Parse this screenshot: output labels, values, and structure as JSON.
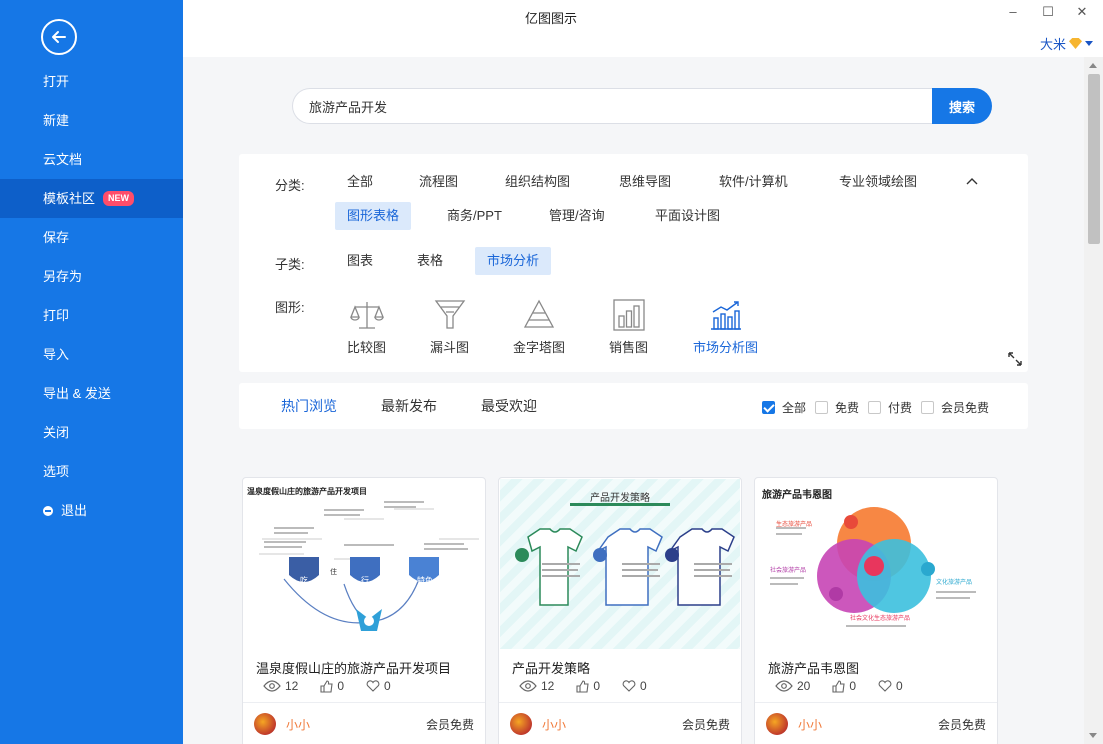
{
  "app": {
    "title": "亿图图示",
    "user": "大米"
  },
  "window": {
    "minimize": "–",
    "maximize": "☐",
    "close": "✕"
  },
  "sidebar": {
    "items": [
      {
        "label": "打开"
      },
      {
        "label": "新建"
      },
      {
        "label": "云文档"
      },
      {
        "label": "模板社区",
        "badge": "NEW"
      },
      {
        "label": "保存"
      },
      {
        "label": "另存为"
      },
      {
        "label": "打印"
      },
      {
        "label": "导入"
      },
      {
        "label": "导出 & 发送"
      },
      {
        "label": "关闭"
      },
      {
        "label": "选项"
      },
      {
        "label": "退出"
      }
    ]
  },
  "search": {
    "value": "旅游产品开发",
    "button": "搜索"
  },
  "filter": {
    "category_label": "分类:",
    "categories": [
      "全部",
      "流程图",
      "组织结构图",
      "思维导图",
      "软件/计算机",
      "专业领域绘图",
      "图形表格",
      "商务/PPT",
      "管理/咨询",
      "平面设计图"
    ],
    "subcategory_label": "子类:",
    "subcategories": [
      "图表",
      "表格",
      "市场分析"
    ],
    "shape_label": "图形:",
    "shapes": [
      {
        "label": "比较图",
        "icon": "scale-icon"
      },
      {
        "label": "漏斗图",
        "icon": "funnel-icon"
      },
      {
        "label": "金字塔图",
        "icon": "pyramid-icon"
      },
      {
        "label": "销售图",
        "icon": "bar-chart-icon"
      },
      {
        "label": "市场分析图",
        "icon": "market-chart-icon"
      }
    ]
  },
  "sort": {
    "tabs": [
      "热门浏览",
      "最新发布",
      "最受欢迎"
    ],
    "filters": [
      {
        "label": "全部",
        "checked": true
      },
      {
        "label": "免费",
        "checked": false
      },
      {
        "label": "付费",
        "checked": false
      },
      {
        "label": "会员免费",
        "checked": false
      }
    ]
  },
  "cards": [
    {
      "title": "温泉度假山庄的旅游产品开发项目",
      "thumb_title": "温泉度假山庄的旅游产品开发项目",
      "views": "12",
      "likes": "0",
      "favs": "0",
      "author": "小小",
      "price": "会员免费"
    },
    {
      "title": "产品开发策略",
      "thumb_title": "产品开发策略",
      "views": "12",
      "likes": "0",
      "favs": "0",
      "author": "小小",
      "price": "会员免费"
    },
    {
      "title": "旅游产品韦恩图",
      "thumb_title": "旅游产品韦恩图",
      "views": "20",
      "likes": "0",
      "favs": "0",
      "author": "小小",
      "price": "会员免费"
    }
  ],
  "thumb_text": {
    "card1_nodes": [
      "吃",
      "住",
      "行",
      "特色"
    ],
    "card3_labels": [
      "生态旅游产品",
      "文化旅游产品",
      "社会旅游产品",
      "社会文化生态旅游产品"
    ]
  }
}
